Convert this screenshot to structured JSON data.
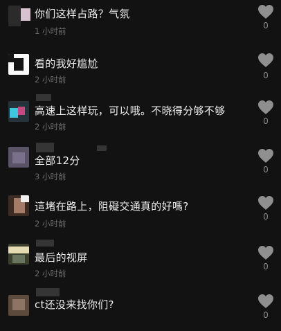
{
  "comments": [
    {
      "text": "你们这样占路？气氛",
      "time": "1 小时前",
      "likes": "0"
    },
    {
      "text": "看的我好尴尬",
      "time": "2 小时前",
      "likes": "0"
    },
    {
      "text": "高速上这样玩，可以哦。不晓得分够不够",
      "time": "2 小时前",
      "likes": "0"
    },
    {
      "text": "全部12分",
      "time": "3 小时前",
      "likes": "0"
    },
    {
      "text": "這堵在路上，阻礙交通真的好嗎?",
      "time": "2 小时前",
      "likes": "0"
    },
    {
      "text": "最后的视屏",
      "time": "2 小时前",
      "likes": "0"
    },
    {
      "text": "ct还没来找你们?",
      "time": "",
      "likes": "0"
    }
  ],
  "icons": {
    "like": "heart-icon"
  },
  "colors": {
    "background": "#121212",
    "text": "#ededed",
    "meta": "#6e6e6e",
    "heart": "#8f8f8f"
  }
}
